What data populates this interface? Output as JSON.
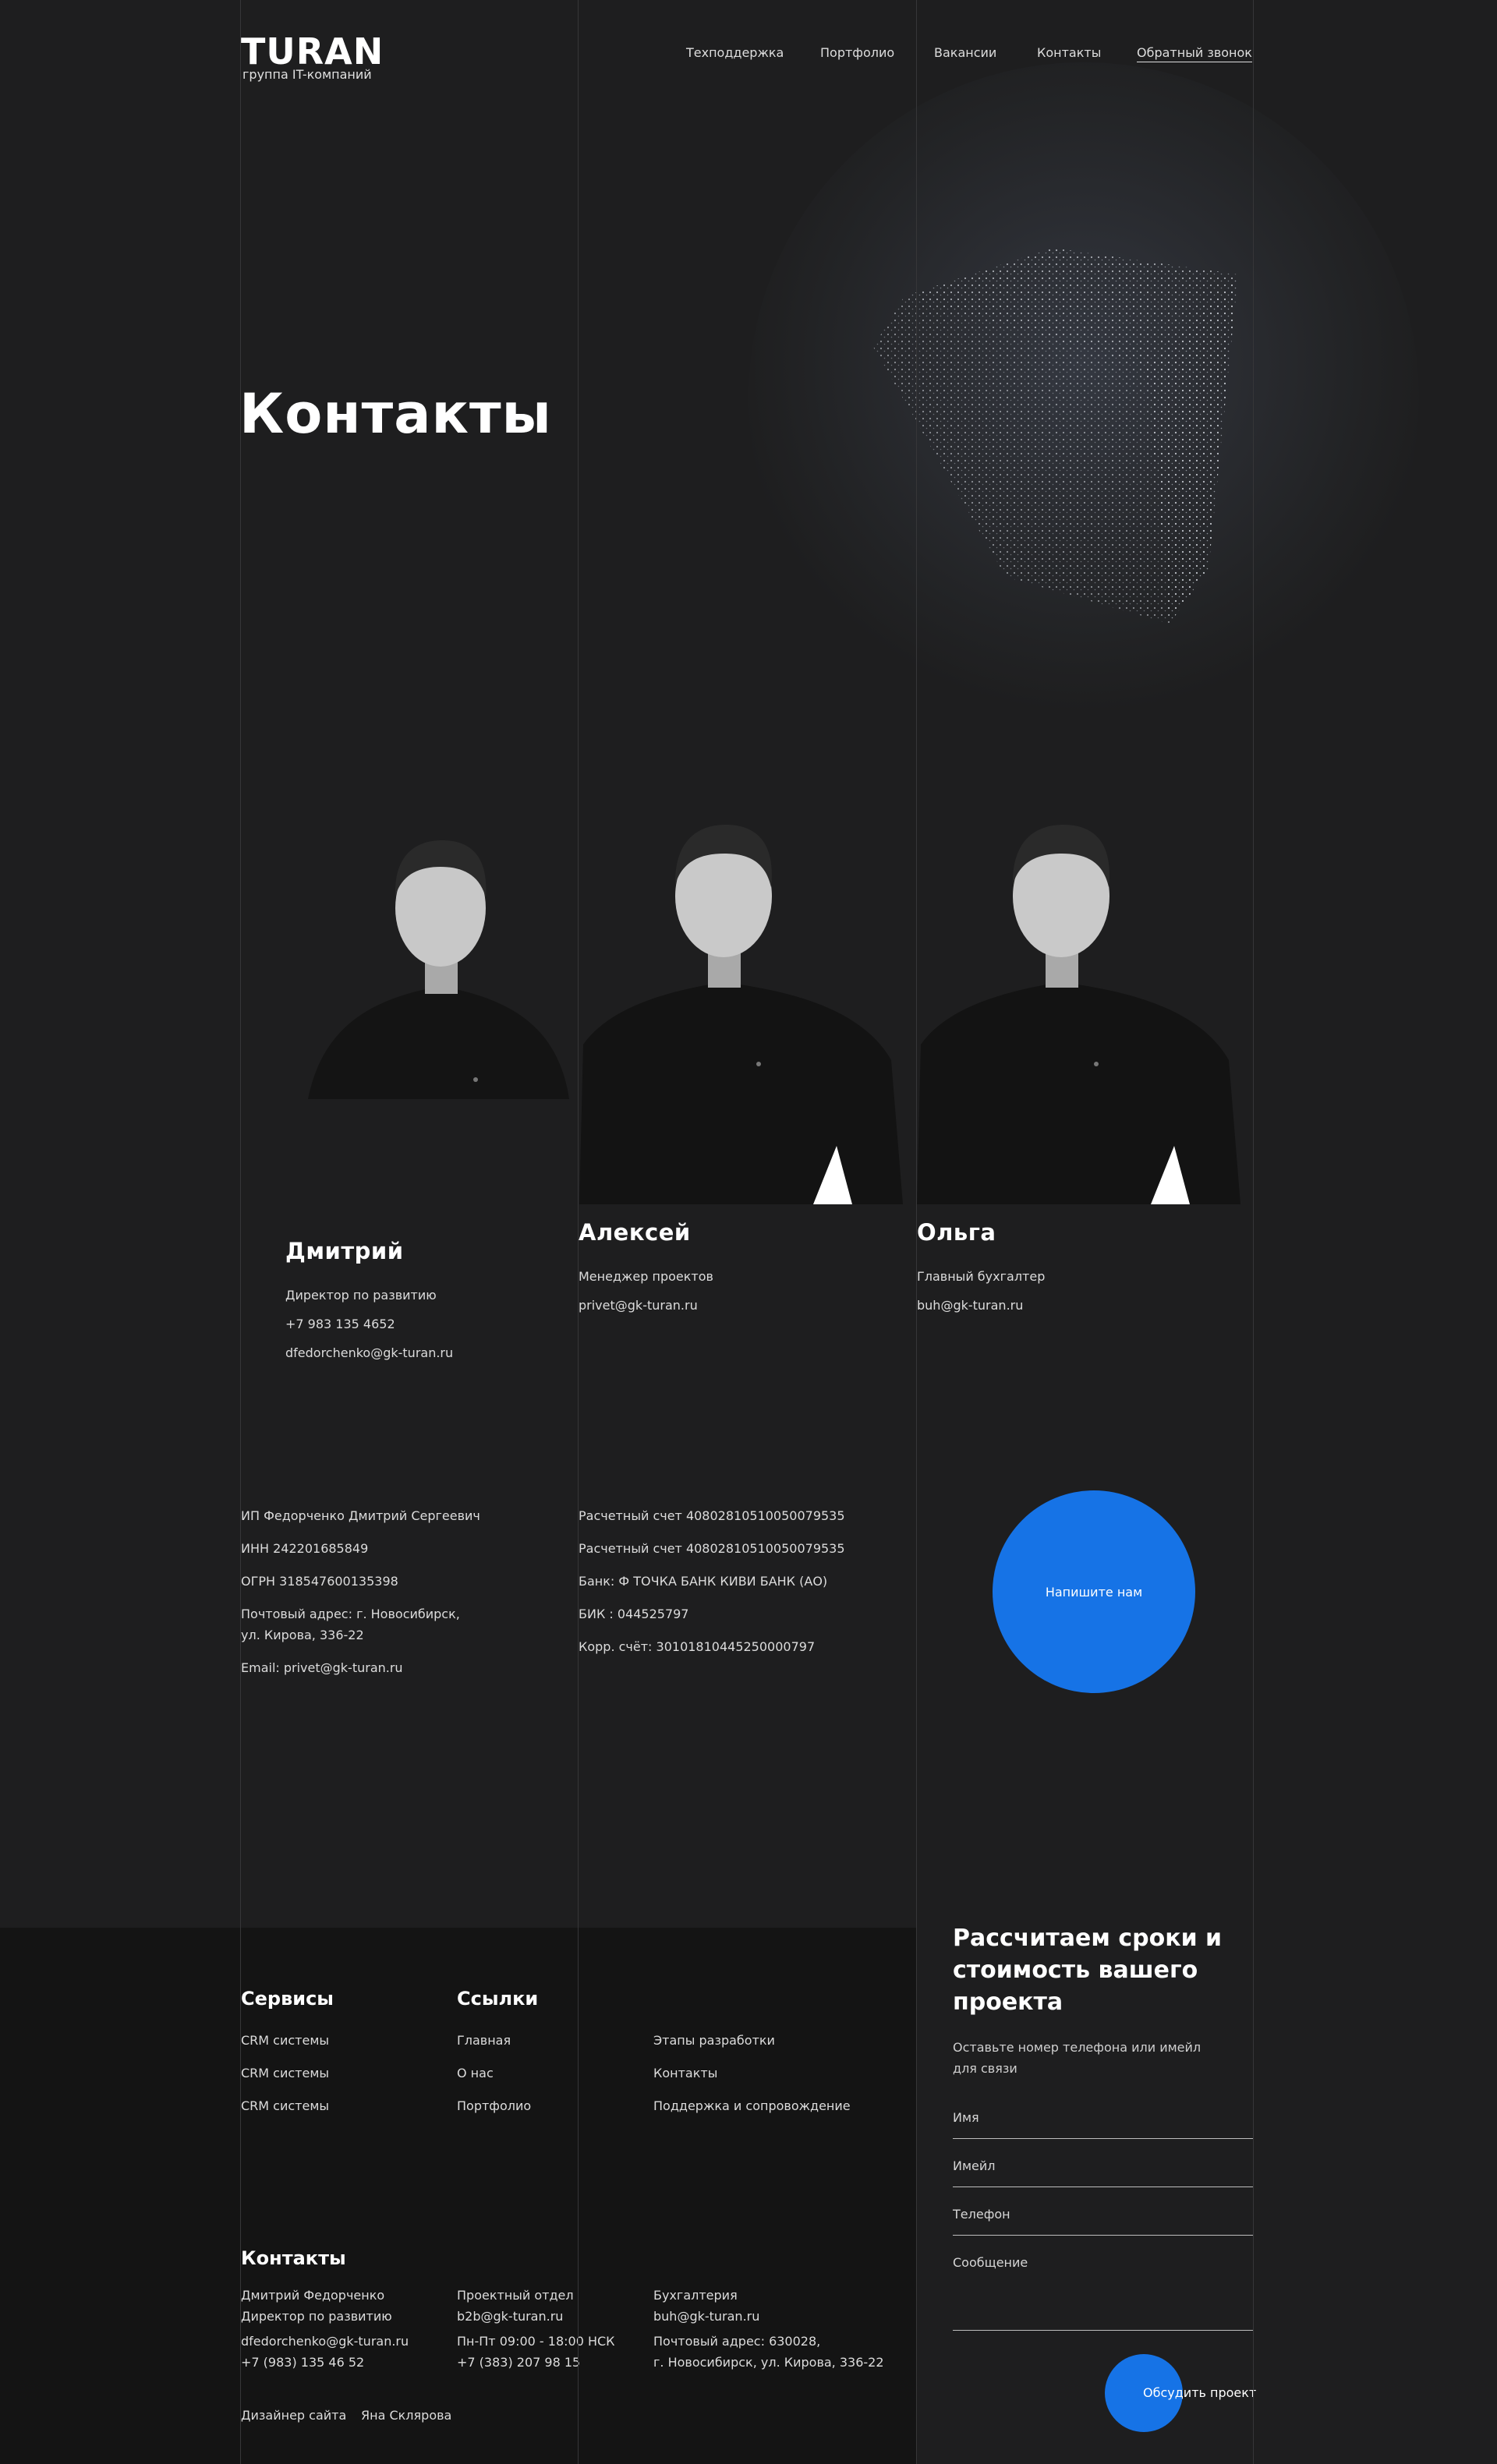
{
  "header": {
    "logo_title": "TURAN",
    "logo_subtitle": "группа IT-компаний",
    "nav": [
      "Техподдержка",
      "Портфолио",
      "Вакансии",
      "Контакты"
    ],
    "callback": "Обратный звонок"
  },
  "hero": {
    "title": "Контакты"
  },
  "team": [
    {
      "name": "Дмитрий",
      "role": "Директор по развитию",
      "phone": "+7 983 135 4652",
      "email": "dfedorchenko@gk-turan.ru"
    },
    {
      "name": "Алексей",
      "role": "Менеджер проектов",
      "email": "privet@gk-turan.ru"
    },
    {
      "name": "Ольга",
      "role": "Главный бухгалтер",
      "email": "buh@gk-turan.ru"
    }
  ],
  "requisites": {
    "left": [
      "ИП Федорченко Дмитрий Сергеевич",
      "ИНН 242201685849",
      "ОГРН  318547600135398",
      "Почтовый адрес: г. Новосибирск,",
      "ул. Кирова, 336-22",
      "Email: privet@gk-turan.ru"
    ],
    "right": [
      "Расчетный счет 40802810510050079535",
      "Расчетный счет 40802810510050079535",
      "Банк: Ф ТОЧКА БАНК КИВИ БАНК (АО)",
      "БИК  : 044525797",
      "Корр. счёт: 30101810445250000797"
    ]
  },
  "cta": {
    "label": "Напишите нам"
  },
  "footer": {
    "services_title": "Сервисы",
    "services": [
      "CRM системы",
      "CRM системы",
      "CRM системы"
    ],
    "links_title": "Ссылки",
    "links_col1": [
      "Главная",
      "О нас",
      "Портфолио"
    ],
    "links_col2": [
      "Этапы разработки",
      "Контакты",
      "Поддержка и сопровождение"
    ],
    "contacts_title": "Контакты",
    "contacts": {
      "c1_l1": "Дмитрий Федорченко",
      "c1_l2": "Директор по развитию",
      "c1_l3": "dfedorchenko@gk-turan.ru",
      "c1_l4": "+7 (983) 135 46 52",
      "c2_l1": "Проектный отдел",
      "c2_l2": "b2b@gk-turan.ru",
      "c2_l3": "Пн-Пт 09:00 - 18:00 НСК",
      "c2_l4": "+7 (383) 207 98 15",
      "c3_l1": "Бухгалтерия",
      "c3_l2": "buh@gk-turan.ru",
      "c3_l3": "Почтовый адрес: 630028,",
      "c3_l4": "г. Новосибирск, ул. Кирова, 336-22"
    },
    "designer_label": "Дизайнер сайта",
    "designer_name": "Яна Склярова"
  },
  "form": {
    "title": "Рассчитаем сроки и стоимость вашего проекта",
    "subtitle": "Оставьте номер телефона или имейл для связи",
    "fields": [
      "Имя",
      "Имейл",
      "Телефон",
      "Сообщение"
    ],
    "submit": "Обсудить проект"
  },
  "colors": {
    "accent": "#1673e6",
    "background": "#1e1e1f",
    "footer": "#141414"
  }
}
